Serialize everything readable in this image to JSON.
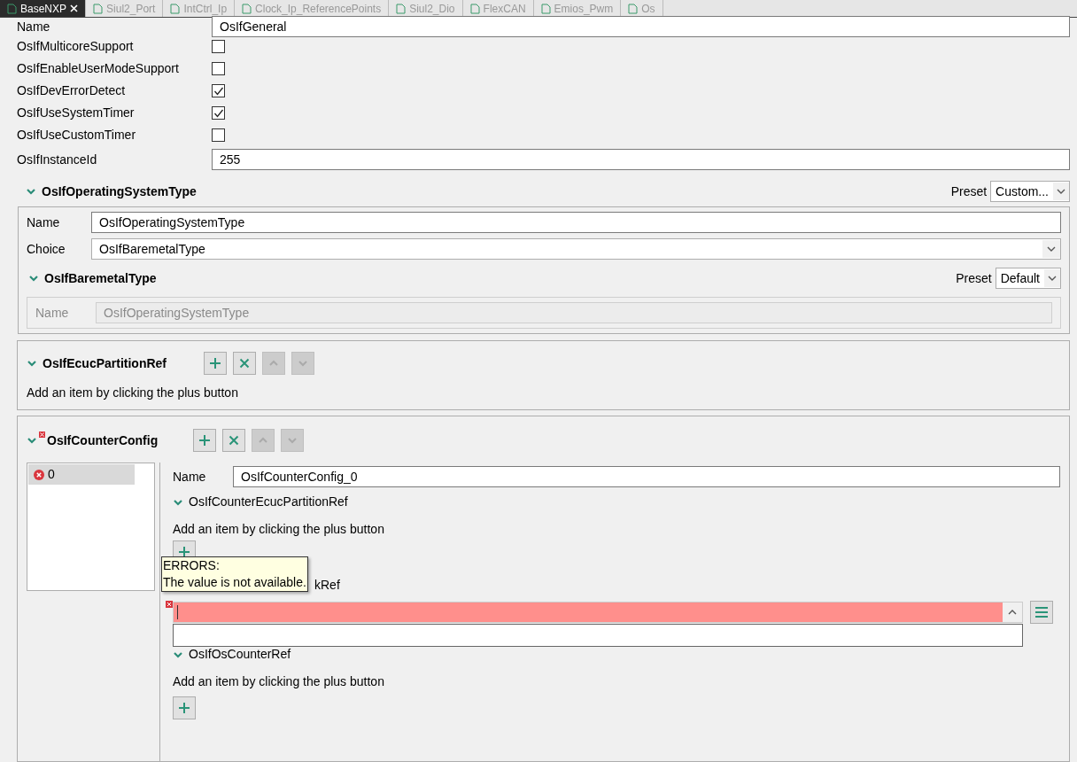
{
  "tabs": [
    {
      "label": "BaseNXP",
      "selected": true
    },
    {
      "label": "Siul2_Port",
      "selected": false
    },
    {
      "label": "IntCtrl_Ip",
      "selected": false
    },
    {
      "label": "Clock_Ip_ReferencePoints",
      "selected": false
    },
    {
      "label": "Siul2_Dio",
      "selected": false
    },
    {
      "label": "FlexCAN",
      "selected": false
    },
    {
      "label": "Emios_Pwm",
      "selected": false
    },
    {
      "label": "Os",
      "selected": false
    }
  ],
  "general": {
    "name_label": "Name",
    "name_value": "OsIfGeneral",
    "params": [
      {
        "kind": "checkbox",
        "label": "OsIfMulticoreSupport",
        "checked": false
      },
      {
        "kind": "checkbox",
        "label": "OsIfEnableUserModeSupport",
        "checked": false
      },
      {
        "kind": "checkbox",
        "label": "OsIfDevErrorDetect",
        "checked": true
      },
      {
        "kind": "checkbox",
        "label": "OsIfUseSystemTimer",
        "checked": true
      },
      {
        "kind": "checkbox",
        "label": "OsIfUseCustomTimer",
        "checked": false
      },
      {
        "kind": "text",
        "label": "OsIfInstanceId",
        "value": "255"
      }
    ]
  },
  "os_type": {
    "title": "OsIfOperatingSystemType",
    "expanded": true,
    "preset_label": "Preset",
    "preset_value": "Custom...",
    "name_label": "Name",
    "name_value": "OsIfOperatingSystemType",
    "choice_label": "Choice",
    "choice_value": "OsIfBaremetalType",
    "sub": {
      "title": "OsIfBaremetalType",
      "expanded": true,
      "preset_label": "Preset",
      "preset_value": "Default",
      "name_label": "Name",
      "name_value": "OsIfOperatingSystemType",
      "disabled": true
    }
  },
  "partition_ref": {
    "title": "OsIfEcucPartitionRef",
    "expanded": true,
    "hint": "Add an item by clicking the plus button"
  },
  "counter_config": {
    "title": "OsIfCounterConfig",
    "expanded": true,
    "error": true,
    "list": [
      {
        "label": "0",
        "selected": true,
        "error": true
      }
    ],
    "name_label": "Name",
    "name_value": "OsIfCounterConfig_0",
    "partition": {
      "title": "OsIfCounterEcucPartitionRef",
      "expanded": true,
      "hint": "Add an item by clicking the plus button"
    },
    "clock_ref": {
      "title_visible": "kRef",
      "error": true,
      "tooltip_title": "ERRORS:",
      "tooltip_text": "The value is not available."
    },
    "os_counter": {
      "title": "OsIfOsCounterRef",
      "expanded": true,
      "hint": "Add an item by clicking the plus button"
    }
  }
}
